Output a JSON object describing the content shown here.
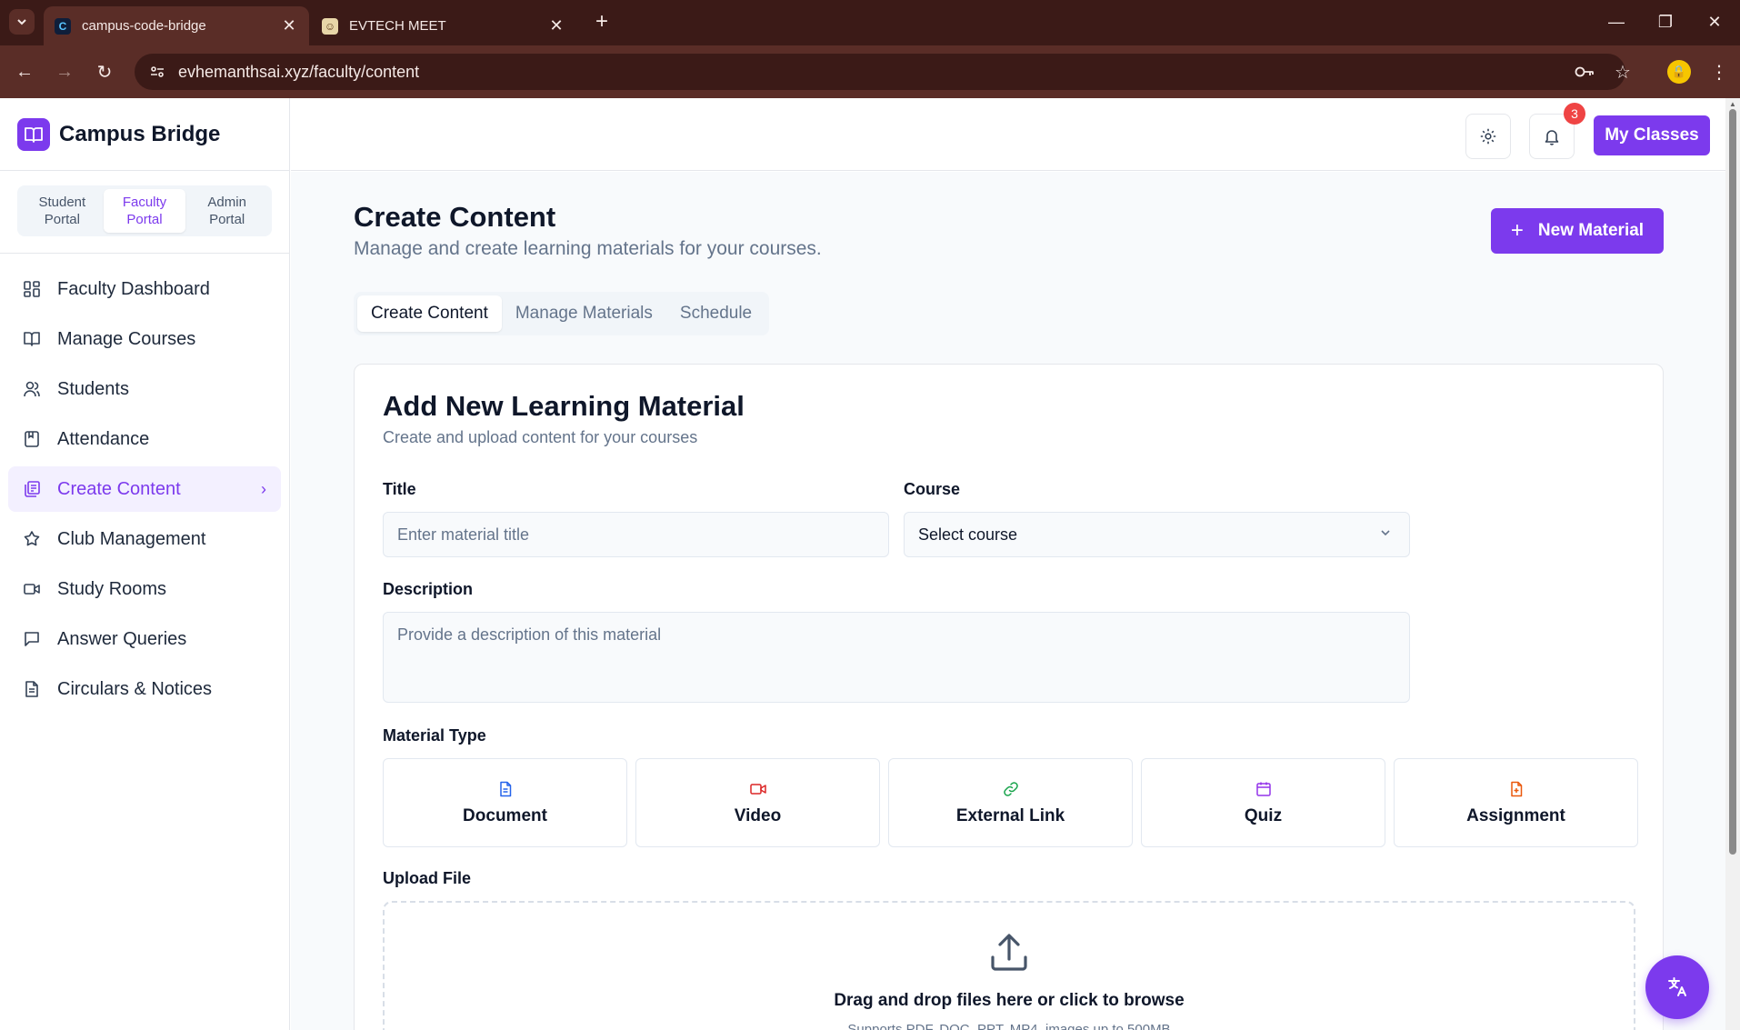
{
  "browser": {
    "tabs": [
      {
        "title": "campus-code-bridge",
        "favicon": "C",
        "active": true
      },
      {
        "title": "EVTECH MEET",
        "favicon": "☺",
        "active": false
      }
    ],
    "url": "evhemanthsai.xyz/faculty/content"
  },
  "app": {
    "brand": "Campus Bridge",
    "portals": [
      {
        "label": "Student\nPortal",
        "active": false
      },
      {
        "label": "Faculty\nPortal",
        "active": true
      },
      {
        "label": "Admin\nPortal",
        "active": false
      }
    ],
    "nav": [
      {
        "label": "Faculty Dashboard",
        "icon": "dashboard-icon"
      },
      {
        "label": "Manage Courses",
        "icon": "book-icon"
      },
      {
        "label": "Students",
        "icon": "users-icon"
      },
      {
        "label": "Attendance",
        "icon": "attendance-icon"
      },
      {
        "label": "Create Content",
        "icon": "content-icon",
        "active": true
      },
      {
        "label": "Club Management",
        "icon": "club-icon"
      },
      {
        "label": "Study Rooms",
        "icon": "video-icon"
      },
      {
        "label": "Answer Queries",
        "icon": "message-icon"
      },
      {
        "label": "Circulars & Notices",
        "icon": "document-icon"
      }
    ],
    "header": {
      "notification_count": "3",
      "my_classes": "My Classes"
    },
    "accent": "#7c3aed"
  },
  "page": {
    "title": "Create Content",
    "subtitle": "Manage and create learning materials for your courses.",
    "new_material": "New Material",
    "tabs": [
      "Create Content",
      "Manage Materials",
      "Schedule"
    ],
    "active_tab": "Create Content"
  },
  "form": {
    "title": "Add New Learning Material",
    "subtitle": "Create and upload content for your courses",
    "title_label": "Title",
    "title_placeholder": "Enter material title",
    "course_label": "Course",
    "course_value": "Select course",
    "description_label": "Description",
    "description_placeholder": "Provide a description of this material",
    "material_type_label": "Material Type",
    "material_types": [
      {
        "label": "Document",
        "icon": "document-icon",
        "color": "#2563eb"
      },
      {
        "label": "Video",
        "icon": "video-icon",
        "color": "#dc2626"
      },
      {
        "label": "External Link",
        "icon": "link-icon",
        "color": "#16a34a"
      },
      {
        "label": "Quiz",
        "icon": "calendar-icon",
        "color": "#9333ea"
      },
      {
        "label": "Assignment",
        "icon": "file-plus-icon",
        "color": "#ea580c"
      }
    ],
    "upload_label": "Upload File",
    "upload_title": "Drag and drop files here or click to browse",
    "upload_sub": "Supports PDF, DOC, PPT, MP4, images up to 500MB"
  }
}
